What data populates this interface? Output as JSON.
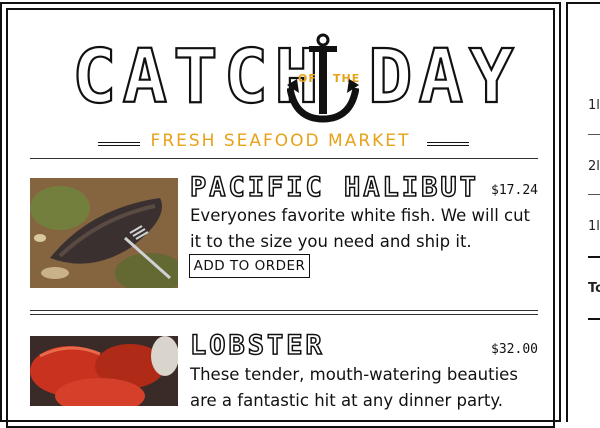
{
  "brand": {
    "logo_left": "CATCH",
    "logo_mid_of": "OF",
    "logo_mid_the": "THE",
    "logo_right": "DAY",
    "tagline": "FRESH SEAFOOD MARKET",
    "accent_color": "#e8a21a"
  },
  "products": [
    {
      "name": "PACIFIC HALIBUT",
      "price": "$17.24",
      "description": "Everyones favorite white fish. We will cut it to the size you need and ship it.",
      "button_label": "ADD TO ORDER",
      "image": "halibut-photo"
    },
    {
      "name": "LOBSTER",
      "price": "$32.00",
      "description": "These tender, mouth-watering beauties are a fantastic hit at any dinner party.",
      "image": "lobster-photo"
    }
  ],
  "order_panel": {
    "rows": [
      "1l",
      "2l",
      "1l"
    ],
    "total_label": "To"
  }
}
